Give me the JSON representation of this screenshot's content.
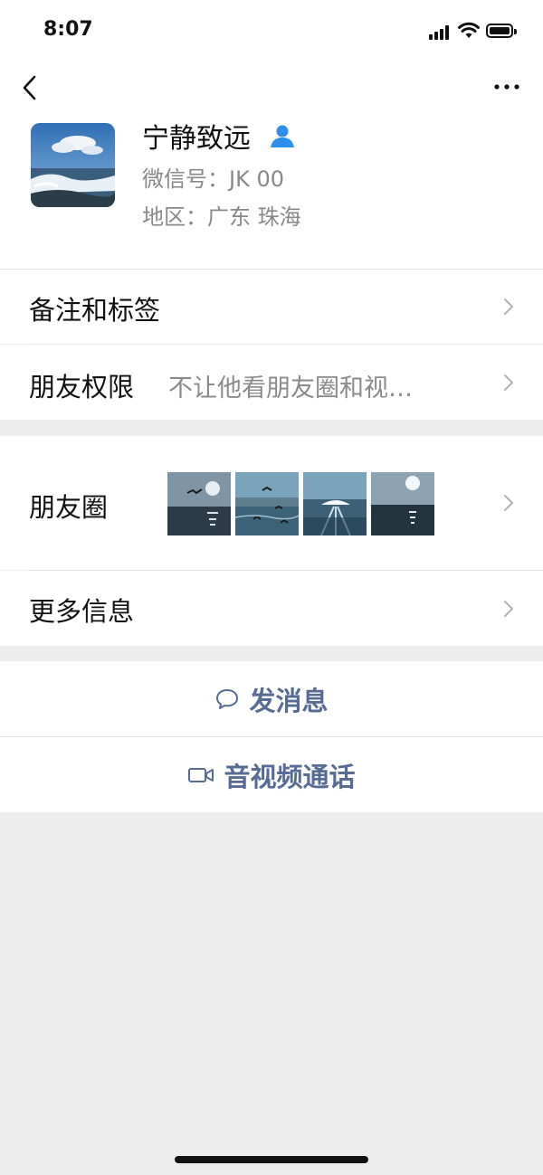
{
  "status_bar": {
    "time": "8:07"
  },
  "profile": {
    "name": "宁静致远",
    "wechat_id": "微信号：JK          00",
    "region": "地区：广东 珠海"
  },
  "rows": {
    "remarks_tags": "备注和标签",
    "friend_permissions_label": "朋友权限",
    "friend_permissions_value": "不让他看朋友圈和视…",
    "moments": "朋友圈",
    "more_info": "更多信息"
  },
  "actions": {
    "send_message": "发消息",
    "video_call": "音视频通话"
  },
  "colors": {
    "accent_blue": "#576b95",
    "background": "#ededed",
    "person_icon": "#2f8ee9"
  },
  "icons": [
    "back-arrow-icon",
    "more-icon",
    "person-icon",
    "chevron-right-icon",
    "chat-bubble-icon",
    "video-camera-icon"
  ]
}
